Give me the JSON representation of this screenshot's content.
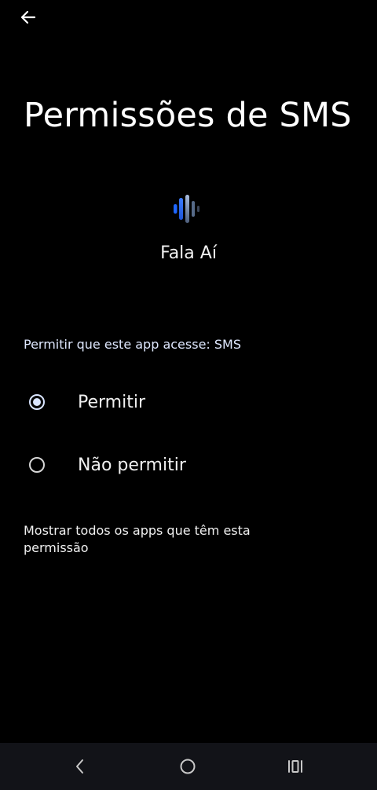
{
  "page": {
    "title": "Permissões de SMS"
  },
  "app": {
    "name": "Fala Aí",
    "icon": "voice-wave-icon",
    "icon_colors": [
      "#1e66ff",
      "#3d7dff",
      "#9fb4d9",
      "#566a88"
    ]
  },
  "permission": {
    "question": "Permitir que este app acesse: SMS",
    "options": [
      {
        "label": "Permitir",
        "selected": true
      },
      {
        "label": "Não permitir",
        "selected": false
      }
    ]
  },
  "links": {
    "show_all": "Mostrar todos os apps que têm esta permissão"
  },
  "navigation": {
    "back_icon": "arrow-left-icon",
    "system_back_icon": "chevron-left-icon",
    "home_icon": "circle-home-icon",
    "recents_icon": "recents-icon"
  },
  "colors": {
    "background": "#000000",
    "accent": "#d8e4ff",
    "nav_bar": "#121318"
  }
}
